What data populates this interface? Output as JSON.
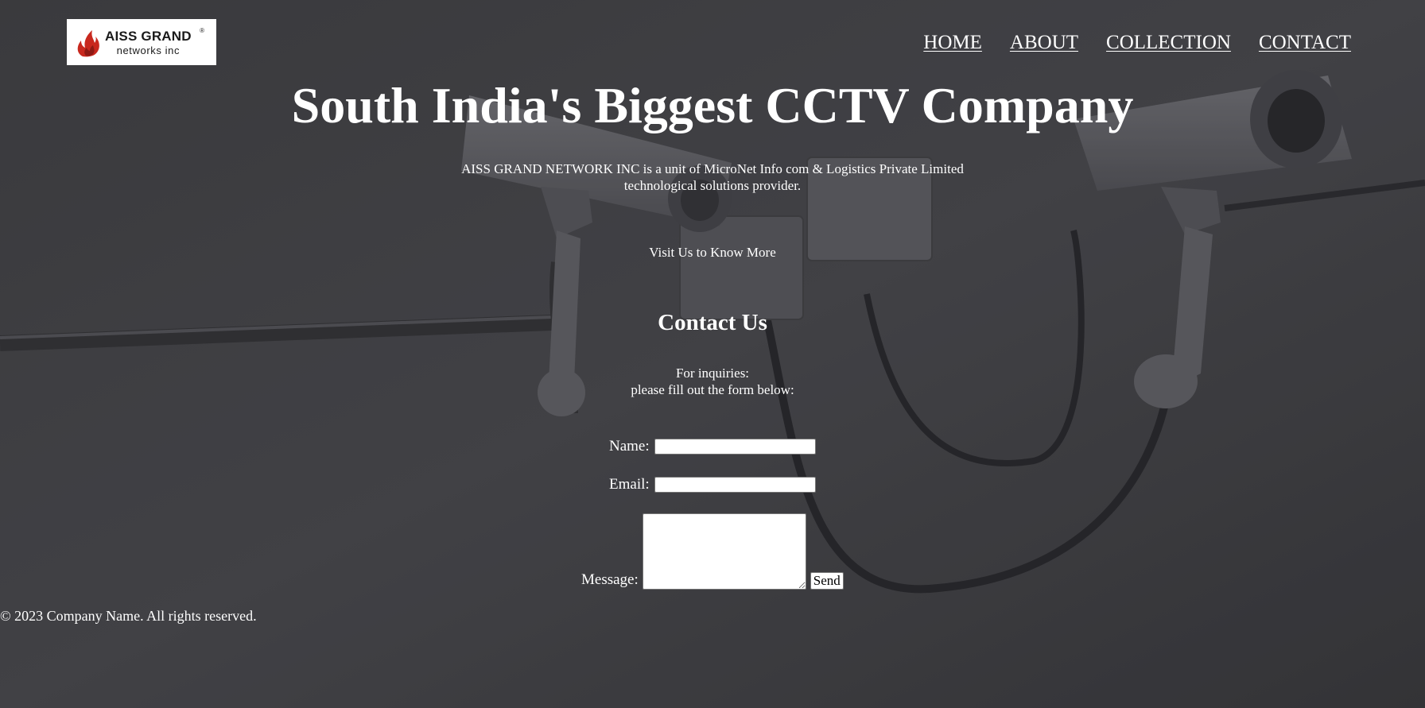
{
  "brand": {
    "logo_line1": "AISS GRAND",
    "logo_line2": "networks inc",
    "registered_mark": "®"
  },
  "nav": {
    "items": [
      {
        "label": "HOME"
      },
      {
        "label": "ABOUT"
      },
      {
        "label": "COLLECTION"
      },
      {
        "label": "CONTACT"
      }
    ]
  },
  "hero": {
    "title": "South India's Biggest CCTV Company",
    "tagline": "AISS GRAND NETWORK INC is a unit of MicroNet Info com & Logistics Private Limited technological solutions provider.",
    "cta_label": "Visit Us to Know More"
  },
  "contact": {
    "title": "Contact Us",
    "inquiry_line1": "For inquiries:",
    "inquiry_line2": "please fill out the form below:",
    "name_label": "Name:",
    "name_value": "",
    "email_label": "Email:",
    "email_value": "",
    "message_label": "Message:",
    "message_value": "",
    "send_label": "Send"
  },
  "footer": {
    "copyright": "© 2023 Company Name. All rights reserved."
  },
  "colors": {
    "background": "#4a4a4e",
    "text": "#ffffff",
    "logo_flame": "#c8281e"
  }
}
